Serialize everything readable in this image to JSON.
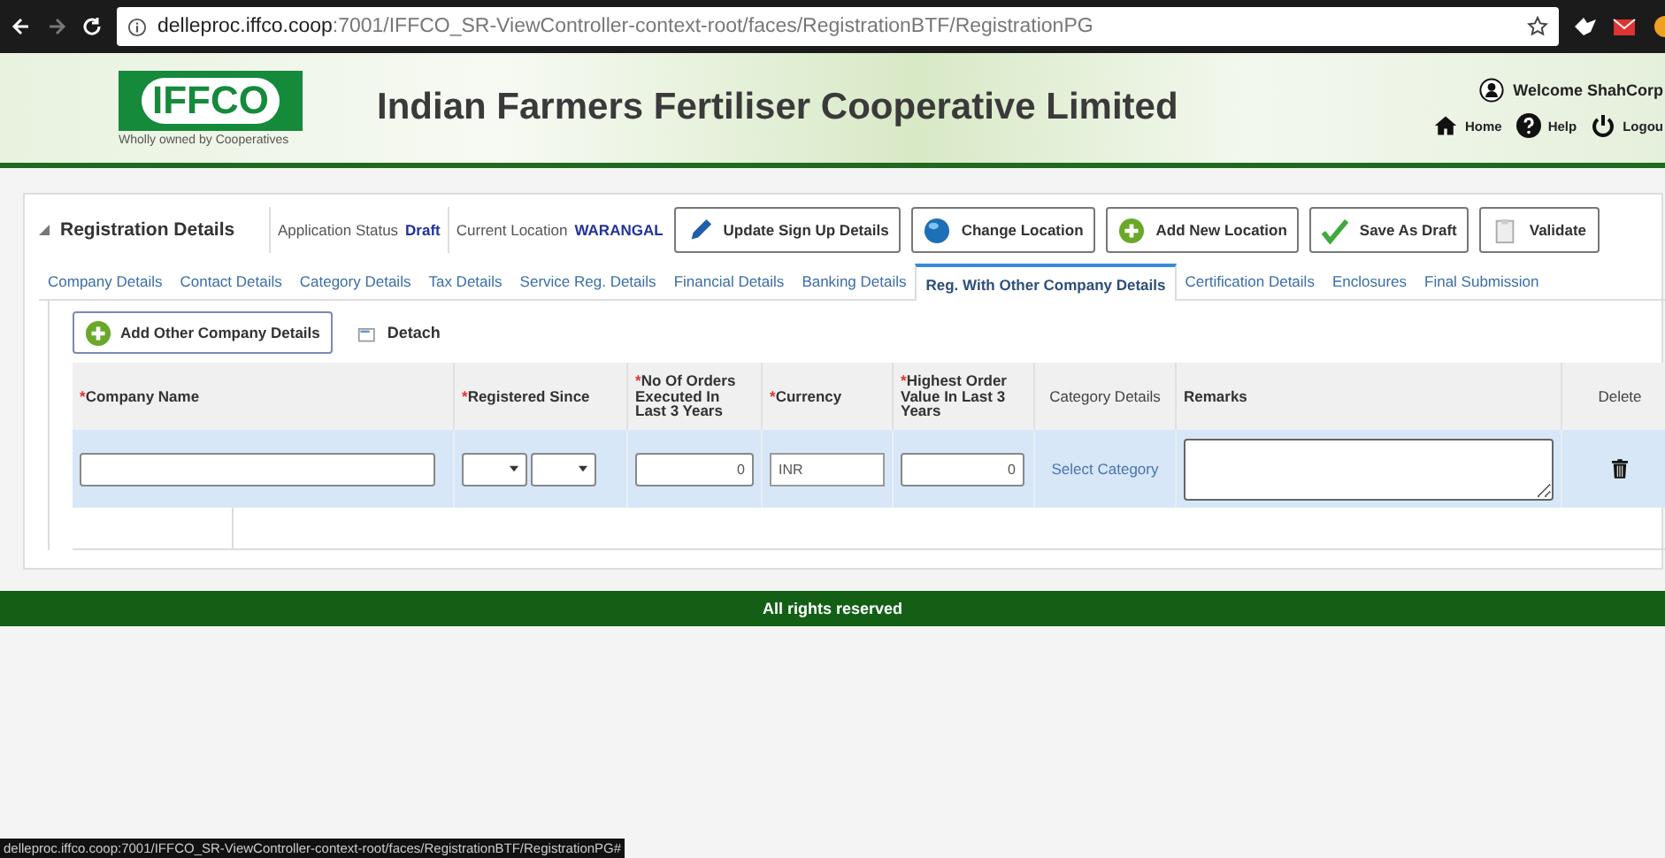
{
  "browser": {
    "url_host": "delleproc.iffco.coop",
    "url_path": ":7001/IFFCO_SR-ViewController-context-root/faces/RegistrationBTF/RegistrationPG",
    "status_link": "delleproc.iffco.coop:7001/IFFCO_SR-ViewController-context-root/faces/RegistrationBTF/RegistrationPG#"
  },
  "header": {
    "logo": "IFFCO",
    "tagline": "Wholly owned by Cooperatives",
    "title": "Indian Farmers Fertiliser Cooperative Limited",
    "welcome": "Welcome ShahCorp",
    "links": [
      {
        "kind": "home",
        "label": "Home"
      },
      {
        "kind": "help",
        "label": "Help"
      },
      {
        "kind": "power",
        "label": "Logou"
      }
    ]
  },
  "panel": {
    "title": "Registration Details",
    "expanded": true,
    "status_label": "Application Status",
    "status_value": "Draft",
    "location_label": "Current Location",
    "location_value": "WARANGAL",
    "actions": [
      {
        "kind": "pencil",
        "label": "Update Sign Up Details"
      },
      {
        "kind": "globe",
        "label": "Change Location"
      },
      {
        "kind": "plus",
        "label": "Add New Location"
      },
      {
        "kind": "check",
        "label": "Save As Draft"
      },
      {
        "kind": "clipboard",
        "label": "Validate"
      }
    ],
    "tabs": [
      {
        "label": "Company Details",
        "selected": false
      },
      {
        "label": "Contact Details",
        "selected": false
      },
      {
        "label": "Category Details",
        "selected": false
      },
      {
        "label": "Tax Details",
        "selected": false
      },
      {
        "label": "Service Reg. Details",
        "selected": false
      },
      {
        "label": "Financial Details",
        "selected": false
      },
      {
        "label": "Banking Details",
        "selected": false
      },
      {
        "label": "Reg. With Other Company Details",
        "selected": true
      },
      {
        "label": "Certification Details",
        "selected": false
      },
      {
        "label": "Enclosures",
        "selected": false
      },
      {
        "label": "Final Submission",
        "selected": false
      }
    ],
    "add_button": "Add Other Company Details",
    "detach": "Detach",
    "columns": [
      {
        "label": "Company Name",
        "marker": "*"
      },
      {
        "label": "Registered Since",
        "marker": "*"
      },
      {
        "label": "No Of Orders Executed In Last 3 Years",
        "marker": "*"
      },
      {
        "label": "Currency",
        "marker": "*"
      },
      {
        "label": "Highest Order Value In Last 3 Years",
        "marker": "*"
      },
      {
        "label": "Category Details"
      },
      {
        "label": "Remarks"
      },
      {
        "label": "Delete"
      }
    ],
    "row": {
      "selected": true,
      "orders": "0",
      "currency": "INR",
      "highest": "0",
      "category_link": "Select Category"
    }
  },
  "footer": "All rights reserved"
}
